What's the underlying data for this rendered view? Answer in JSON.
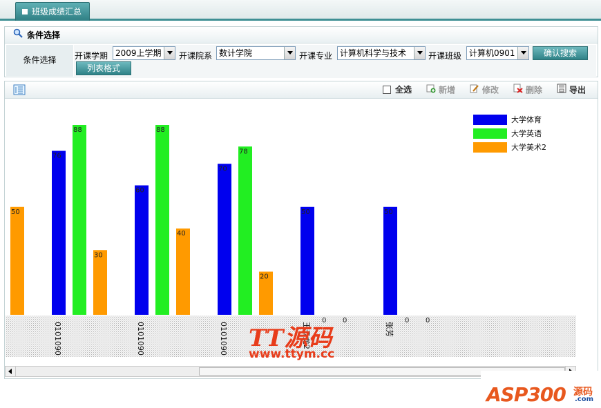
{
  "tab": {
    "label": "班级成绩汇总"
  },
  "condition": {
    "header": "条件选择",
    "row_label": "条件选择",
    "term_label": "开课学期",
    "term_value": "2009上学期",
    "college_label": "开课院系",
    "college_value": "数计学院",
    "major_label": "开课专业",
    "major_value": "计算机科学与技术",
    "class_label": "开课班级",
    "class_value": "计算机0901",
    "search_button": "确认搜索",
    "list_button": "列表格式"
  },
  "toolbar": {
    "select_all": "全选",
    "add": "新增",
    "edit": "修改",
    "delete": "删除",
    "export": "导出"
  },
  "chart_data": {
    "type": "bar",
    "categories": [
      "0101090",
      "0101090",
      "0101090",
      "王云龙2",
      "张芳"
    ],
    "series": [
      {
        "name": "大学体育",
        "color": "#0000ee",
        "values": [
          76,
          60,
          70,
          50,
          50
        ]
      },
      {
        "name": "大学英语",
        "color": "#22ee22",
        "values": [
          88,
          88,
          78,
          0,
          0
        ]
      },
      {
        "name": "大学美术2",
        "color": "#ff9a00",
        "values": [
          30,
          40,
          20,
          0,
          0
        ]
      }
    ],
    "lead_bar": {
      "value": 50,
      "color": "#ff9a00"
    },
    "ylim": [
      0,
      100
    ],
    "legend_position": "top-right",
    "grid": false
  },
  "watermarks": {
    "brand1": "TT源码",
    "brand1_url": "www.ttym.cc",
    "brand2": "ASP300",
    "brand2_suffix": "源码",
    "brand2_domain": ".com"
  },
  "colors": {
    "accent": "#3e8f94",
    "tab": "#2f7f84"
  }
}
